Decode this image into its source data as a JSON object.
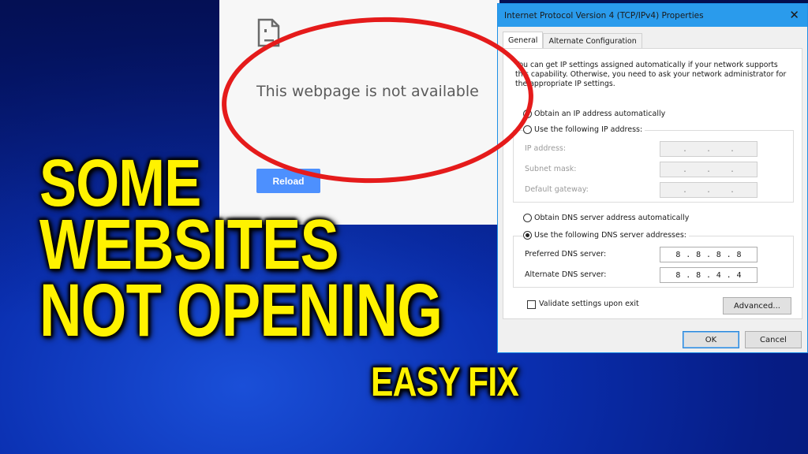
{
  "browser": {
    "icon": "sad-document-icon",
    "error_message": "This webpage is not available",
    "reload_label": "Reload",
    "reload_color": "#4d90fe"
  },
  "annotation": {
    "circle_color": "#e51b1b"
  },
  "dialog": {
    "title": "Internet Protocol Version 4 (TCP/IPv4) Properties",
    "close_icon": "close-icon",
    "tabs": [
      {
        "label": "General",
        "active": true
      },
      {
        "label": "Alternate Configuration",
        "active": false
      }
    ],
    "description": "You can get IP settings assigned automatically if your network supports this capability. Otherwise, you need to ask your network administrator for the appropriate IP settings.",
    "ip_mode": {
      "auto_label": "Obtain an IP address automatically",
      "manual_label": "Use the following IP address:",
      "selected": "auto"
    },
    "ip_fields": [
      {
        "label": "IP address:",
        "value": " .  .  . "
      },
      {
        "label": "Subnet mask:",
        "value": " .  .  . "
      },
      {
        "label": "Default gateway:",
        "value": " .  .  . "
      }
    ],
    "dns_mode": {
      "auto_label": "Obtain DNS server address automatically",
      "manual_label": "Use the following DNS server addresses:",
      "selected": "manual"
    },
    "dns_fields": [
      {
        "label": "Preferred DNS server:",
        "octets": [
          "8",
          ".",
          "8",
          ".",
          "8",
          ".",
          "8"
        ]
      },
      {
        "label": "Alternate DNS server:",
        "octets": [
          "8",
          ".",
          "8",
          ".",
          "4",
          ".",
          "4"
        ]
      }
    ],
    "validate_label": "Validate settings upon exit",
    "validate_checked": false,
    "advanced_label": "Advanced...",
    "ok_label": "OK",
    "cancel_label": "Cancel",
    "title_bar_color": "#2a9bec"
  },
  "headline": {
    "line1": "SOME",
    "line2": "WEBSITES",
    "line3": "NOT OPENING",
    "subtitle": "EASY FIX",
    "text_color": "#fff200"
  }
}
